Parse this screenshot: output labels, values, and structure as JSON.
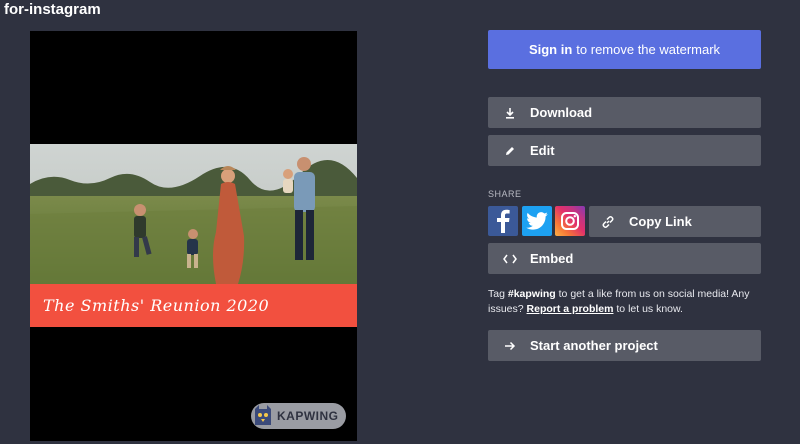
{
  "header": {
    "title": "for-instagram"
  },
  "preview": {
    "banner_text": "The Smiths' Reunion 2020",
    "watermark_text": "KAPWING"
  },
  "actions": {
    "signin_bold": "Sign in",
    "signin_rest": "to remove the watermark",
    "download_label": "Download",
    "edit_label": "Edit"
  },
  "share": {
    "label": "SHARE",
    "facebook_icon": "facebook-icon",
    "twitter_icon": "twitter-icon",
    "instagram_icon": "instagram-icon",
    "copy_link_label": "Copy Link",
    "embed_label": "Embed"
  },
  "info": {
    "tag_prefix": "Tag",
    "hashtag": "#kapwing",
    "tag_middle": "to get a like from us on social media! Any issues?",
    "report_link": "Report a problem",
    "tag_suffix": "to let us know."
  },
  "footer": {
    "start_another_label": "Start another project"
  },
  "colors": {
    "background": "#2f3240",
    "primary": "#5a6fe0",
    "button": "#585b66",
    "banner": "#f2503f"
  }
}
